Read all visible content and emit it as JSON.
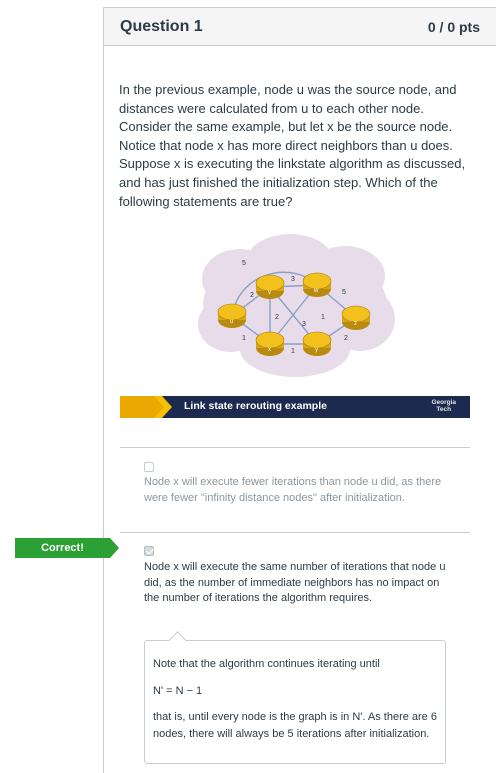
{
  "question": {
    "title": "Question 1",
    "points": "0 / 0 pts",
    "text": "In the previous example, node u was the source node, and distances were calculated from u to each other node. Consider the same example, but let x be the source node. Notice that node x has more direct neighbors than u does. Suppose x is executing the linkstate algorithm as discussed, and has just finished the initialization step. Which of the following statements are true?"
  },
  "figure": {
    "caption": "Link state rerouting example",
    "logo_line1": "Georgia",
    "logo_line2": "Tech",
    "nodes": [
      "u",
      "v",
      "w",
      "x",
      "y",
      "z"
    ],
    "edge_weights": [
      "5",
      "2",
      "3",
      "5",
      "2",
      "3",
      "1",
      "1",
      "1",
      "2"
    ]
  },
  "answers": [
    {
      "text": "Node x will execute fewer iterations than node u did, as there were fewer \"infinity distance nodes\" after initialization.",
      "checked": false
    },
    {
      "text": "Node x will execute the same number of iterations that node u did, as the number of immediate neighbors has no impact on the number of iterations the algorithm requires.",
      "checked": true
    }
  ],
  "correct_label": "Correct!",
  "comment": {
    "line1": "Note that the algorithm continues iterating until",
    "formula": "N' = N − 1",
    "line2": "that is, until every node is the graph is in N'. As there are 6 nodes, there will always be 5 iterations after initialization."
  },
  "colors": {
    "correct": "#2aa035",
    "router": "#f2c11d",
    "band": "#1b2a4e",
    "cloud": "#e8dcea"
  }
}
